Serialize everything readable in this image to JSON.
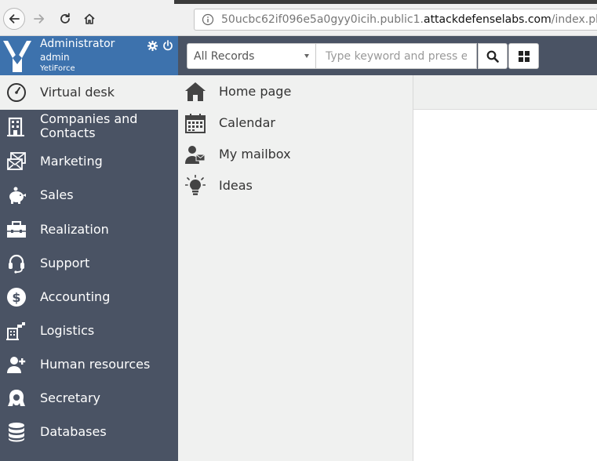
{
  "browser": {
    "url_prefix": "50ucbc62if096e5a0gyy0icih.public1.",
    "url_domain": "attackdefenselabs.com",
    "url_path": "/index.php"
  },
  "user": {
    "name": "Administrator",
    "login": "admin",
    "company": "YetiForce"
  },
  "sidebar": {
    "items": [
      {
        "label": "Virtual desk",
        "icon": "speedometer-icon",
        "active": true
      },
      {
        "label": "Companies and Contacts",
        "icon": "building-icon"
      },
      {
        "label": "Marketing",
        "icon": "envelopes-icon"
      },
      {
        "label": "Sales",
        "icon": "piggy-bank-icon"
      },
      {
        "label": "Realization",
        "icon": "briefcase-icon"
      },
      {
        "label": "Support",
        "icon": "headset-icon"
      },
      {
        "label": "Accounting",
        "icon": "dollar-icon"
      },
      {
        "label": "Logistics",
        "icon": "warehouse-icon"
      },
      {
        "label": "Human resources",
        "icon": "person-add-icon"
      },
      {
        "label": "Secretary",
        "icon": "secretary-icon"
      },
      {
        "label": "Databases",
        "icon": "database-icon"
      }
    ]
  },
  "search": {
    "scope_value": "All Records",
    "placeholder": "Type keyword and press enter"
  },
  "quick_menu": {
    "items": [
      {
        "label": "Home page",
        "icon": "home-icon"
      },
      {
        "label": "Calendar",
        "icon": "calendar-icon"
      },
      {
        "label": "My mailbox",
        "icon": "mail-user-icon"
      },
      {
        "label": "Ideas",
        "icon": "lightbulb-icon"
      }
    ]
  },
  "colors": {
    "sidebar_bg": "#4a5364",
    "user_panel_bg": "#3d72ad",
    "panel_bg": "#f0f1f0"
  }
}
